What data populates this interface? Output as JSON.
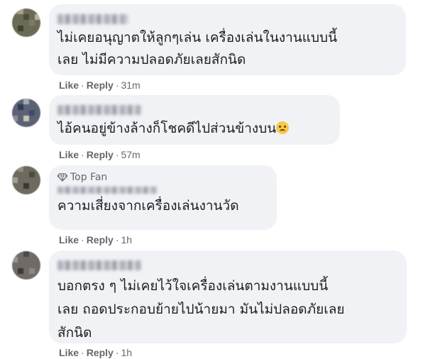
{
  "comments": [
    {
      "text": "ไม่เคยอนุญาตให้ลูกๆเล่น เครื่องเล่นในงานแบบนี้\nเลย ไม่มีความปลอดภัยเลยสักนิด",
      "like": "Like",
      "reply": "Reply",
      "time": "31m",
      "top_fan": null
    },
    {
      "text": "ไอ้คนอยู่ข้างล้างก็โชคดีไปส่วนข้างบน",
      "emoji": "sad-tear-emoji",
      "like": "Like",
      "reply": "Reply",
      "time": "57m",
      "top_fan": null
    },
    {
      "text": "ความเสี่ยงจากเครื่องเล่นงานวัด",
      "like": "Like",
      "reply": "Reply",
      "time": "1h",
      "top_fan": "Top Fan"
    },
    {
      "text": "บอกตรง ๆ ไม่เคยไว้ใจเครื่องเล่นตามงานแบบนี้\nเลย ถอดประกอบย้ายไปน้ายมา มันไม่ปลอดภัยเลย\nสักนิด",
      "like": "Like",
      "reply": "Reply",
      "time": "1h",
      "top_fan": null
    }
  ],
  "separator": "·",
  "colors": {
    "bubble": "#f0f2f5",
    "meta": "#65676b",
    "text": "#1c1e21"
  }
}
